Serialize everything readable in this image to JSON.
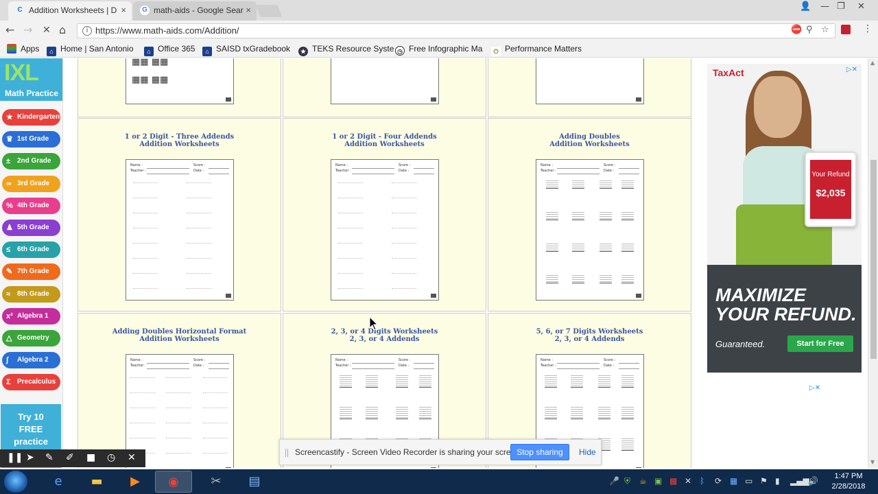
{
  "browser": {
    "tabs": [
      {
        "title": "Addition Worksheets | D",
        "close": "×"
      },
      {
        "title": "math-aids - Google Sear",
        "close": "×"
      }
    ],
    "url": "https://www.math-aids.com/Addition/",
    "bookmarks": [
      {
        "label": "Apps"
      },
      {
        "label": "Home | San Antonio"
      },
      {
        "label": "Office 365"
      },
      {
        "label": "SAISD txGradebook"
      },
      {
        "label": "TEKS Resource Syste"
      },
      {
        "label": "Free Infographic Ma"
      },
      {
        "label": "Performance Matters"
      }
    ]
  },
  "sidebar": {
    "logo": "IXL",
    "subtitle": "Math Practice",
    "grades": [
      {
        "label": "Kindergarten",
        "color": "#e8413c"
      },
      {
        "label": "1st Grade",
        "color": "#2a6fd6"
      },
      {
        "label": "2nd Grade",
        "color": "#3aa53a"
      },
      {
        "label": "3rd Grade",
        "color": "#f0a21c"
      },
      {
        "label": "4th Grade",
        "color": "#e83e8c"
      },
      {
        "label": "5th Grade",
        "color": "#8a3fd1"
      },
      {
        "label": "6th Grade",
        "color": "#27a2a8"
      },
      {
        "label": "7th Grade",
        "color": "#f06a1c"
      },
      {
        "label": "8th Grade",
        "color": "#c49a1c"
      },
      {
        "label": "Algebra 1",
        "color": "#c42d9a"
      },
      {
        "label": "Geometry",
        "color": "#3aa53a"
      },
      {
        "label": "Algebra 2",
        "color": "#2a6fd6"
      },
      {
        "label": "Precalculus",
        "color": "#e8413c"
      }
    ],
    "try_line1": "Try 10",
    "try_line2": "FREE",
    "try_line3": "practice"
  },
  "worksheets": [
    {
      "line1": "1 or 2 Digit - Three Addends",
      "line2": "Addition Worksheets"
    },
    {
      "line1": "1 or 2 Digit - Four Addends",
      "line2": "Addition Worksheets"
    },
    {
      "line1": "Adding Doubles",
      "line2": "Addition Worksheets"
    },
    {
      "line1": "Adding Doubles Horizontal Format",
      "line2": "Addition Worksheets"
    },
    {
      "line1": "2, 3, or 4 Digits Worksheets",
      "line2": "2, 3, or 4 Addends"
    },
    {
      "line1": "5, 6, or 7 Digits Worksheets",
      "line2": "2, 3, or 4 Addends"
    }
  ],
  "thumb_labels": {
    "name": "Name :",
    "teacher": "Teacher :",
    "score": "Score :",
    "date": "Date :"
  },
  "ad": {
    "brand": "TaxAct",
    "tablet_label": "Your Refund",
    "tablet_amount": "$2,035",
    "headline1": "MAXIMIZE",
    "headline2": "YOUR REFUND.",
    "tagline": "Guaranteed.",
    "cta": "Start for Free"
  },
  "screencastify": {
    "message": "Screencastify - Screen Video Recorder is sharing your screen.",
    "stop": "Stop sharing",
    "hide": "Hide"
  },
  "taskbar": {
    "time": "1:47 PM",
    "date": "2/28/2018"
  }
}
